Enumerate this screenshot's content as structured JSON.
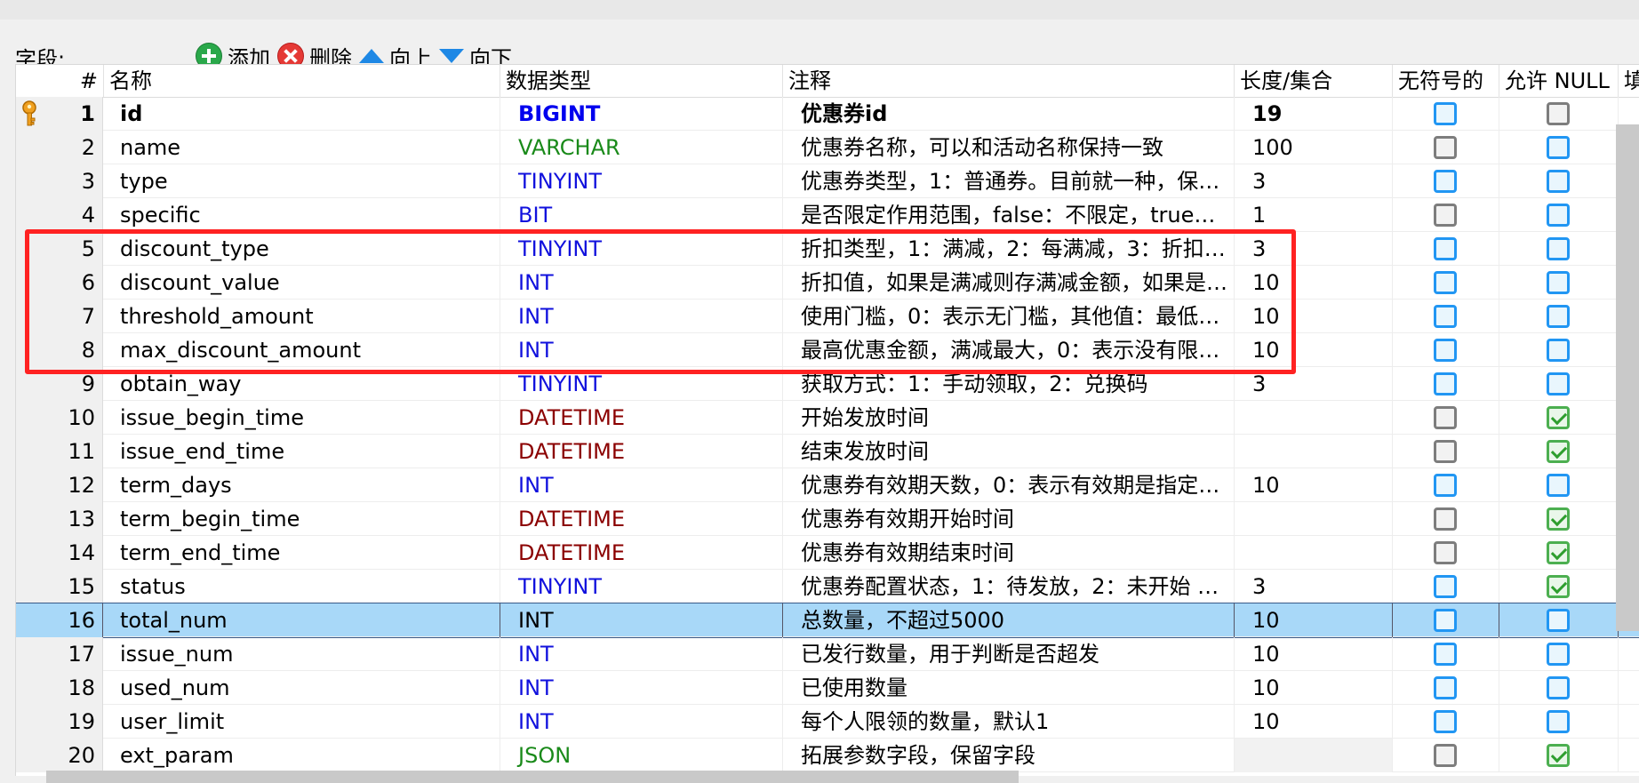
{
  "toolbar": {
    "fields_label": "字段:",
    "add_label": "添加",
    "delete_label": "删除",
    "up_label": "向上",
    "down_label": "向下"
  },
  "columns": {
    "num": "#",
    "name": "名称",
    "dtype": "数据类型",
    "comment": "注释",
    "length": "长度/集合",
    "unsigned": "无符号的",
    "nullable": "允许 NULL",
    "fill": "填零"
  },
  "colors": {
    "BIGINT": "#0000ee",
    "VARCHAR": "#1a8a1a",
    "TINYINT": "#1111dd",
    "BIT": "#1111dd",
    "INT": "#1111dd",
    "DATETIME": "#8b0000",
    "JSON": "#1a8a1a",
    "highlight_box": "#ff2222",
    "selected_row": "#a8d8f8"
  },
  "rows": [
    {
      "num": "1",
      "name": "id",
      "dtype": "BIGINT",
      "comment": "优惠券id",
      "length": "19",
      "unsigned": "blue",
      "nullable": "gray",
      "pk": true
    },
    {
      "num": "2",
      "name": "name",
      "dtype": "VARCHAR",
      "comment": "优惠券名称，可以和活动名称保持一致",
      "length": "100",
      "unsigned": "gray",
      "nullable": "blue"
    },
    {
      "num": "3",
      "name": "type",
      "dtype": "TINYINT",
      "comment": "优惠券类型，1：普通券。目前就一种，保…",
      "length": "3",
      "unsigned": "blue",
      "nullable": "blue"
    },
    {
      "num": "4",
      "name": "specific",
      "dtype": "BIT",
      "comment": "是否限定作用范围，false：不限定，true：…",
      "length": "1",
      "unsigned": "gray",
      "nullable": "blue"
    },
    {
      "num": "5",
      "name": "discount_type",
      "dtype": "TINYINT",
      "comment": "折扣类型，1：满减，2：每满减，3：折扣…",
      "length": "3",
      "unsigned": "blue",
      "nullable": "blue"
    },
    {
      "num": "6",
      "name": "discount_value",
      "dtype": "INT",
      "comment": "折扣值，如果是满减则存满减金额，如果是…",
      "length": "10",
      "unsigned": "blue",
      "nullable": "blue"
    },
    {
      "num": "7",
      "name": "threshold_amount",
      "dtype": "INT",
      "comment": "使用门槛，0：表示无门槛，其他值：最低…",
      "length": "10",
      "unsigned": "blue",
      "nullable": "blue"
    },
    {
      "num": "8",
      "name": "max_discount_amount",
      "dtype": "INT",
      "comment": "最高优惠金额，满减最大，0：表示没有限…",
      "length": "10",
      "unsigned": "blue",
      "nullable": "blue"
    },
    {
      "num": "9",
      "name": "obtain_way",
      "dtype": "TINYINT",
      "comment": "获取方式：1：手动领取，2：兑换码",
      "length": "3",
      "unsigned": "blue",
      "nullable": "blue"
    },
    {
      "num": "10",
      "name": "issue_begin_time",
      "dtype": "DATETIME",
      "comment": "开始发放时间",
      "length": "",
      "unsigned": "gray",
      "nullable": "green"
    },
    {
      "num": "11",
      "name": "issue_end_time",
      "dtype": "DATETIME",
      "comment": "结束发放时间",
      "length": "",
      "unsigned": "gray",
      "nullable": "green"
    },
    {
      "num": "12",
      "name": "term_days",
      "dtype": "INT",
      "comment": "优惠券有效期天数，0：表示有效期是指定…",
      "length": "10",
      "unsigned": "blue",
      "nullable": "blue"
    },
    {
      "num": "13",
      "name": "term_begin_time",
      "dtype": "DATETIME",
      "comment": "优惠券有效期开始时间",
      "length": "",
      "unsigned": "gray",
      "nullable": "green"
    },
    {
      "num": "14",
      "name": "term_end_time",
      "dtype": "DATETIME",
      "comment": "优惠券有效期结束时间",
      "length": "",
      "unsigned": "gray",
      "nullable": "green"
    },
    {
      "num": "15",
      "name": "status",
      "dtype": "TINYINT",
      "comment": "优惠券配置状态，1：待发放，2：未开始 …",
      "length": "3",
      "unsigned": "blue",
      "nullable": "green"
    },
    {
      "num": "16",
      "name": "total_num",
      "dtype": "INT",
      "comment": "总数量，不超过5000",
      "length": "10",
      "unsigned": "blue",
      "nullable": "blue",
      "selected": true
    },
    {
      "num": "17",
      "name": "issue_num",
      "dtype": "INT",
      "comment": "已发行数量，用于判断是否超发",
      "length": "10",
      "unsigned": "blue",
      "nullable": "blue"
    },
    {
      "num": "18",
      "name": "used_num",
      "dtype": "INT",
      "comment": "已使用数量",
      "length": "10",
      "unsigned": "blue",
      "nullable": "blue"
    },
    {
      "num": "19",
      "name": "user_limit",
      "dtype": "INT",
      "comment": "每个人限领的数量，默认1",
      "length": "10",
      "unsigned": "blue",
      "nullable": "blue"
    },
    {
      "num": "20",
      "name": "ext_param",
      "dtype": "JSON",
      "comment": "拓展参数字段，保留字段",
      "length": "",
      "unsigned": "gray",
      "nullable": "green",
      "len_empty": true
    }
  ]
}
